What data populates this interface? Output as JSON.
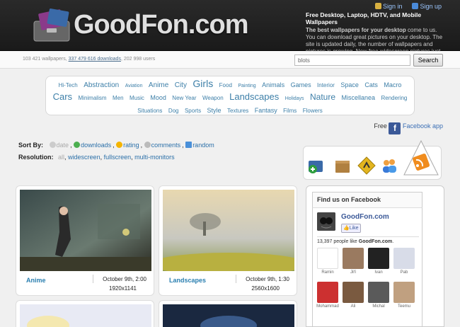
{
  "header": {
    "logo": "GoodFon.com",
    "sign_in": "Sign in",
    "sign_up": "Sign up",
    "tagline_title": "Free Desktop, Laptop, HDTV, and Mobile Wallpapers",
    "tagline_bold": "The best wallpapers for your desktop",
    "tagline_rest": " come to us. You can download great pictures on your desktop. The site is updated daily, the number of wallpapers and pictures is growing. New free widescreen pictures just for you."
  },
  "stats": {
    "wallpapers": "103 421 wallpapers,",
    "downloads": "337 479 616 downloads",
    "users": ", 202 998 users"
  },
  "search": {
    "value": "blots",
    "button": "Search"
  },
  "tags": [
    {
      "t": "Hi-Tech",
      "s": 8
    },
    {
      "t": "Abstraction",
      "s": 10
    },
    {
      "t": "Aviation",
      "s": 7
    },
    {
      "t": "Anime",
      "s": 10
    },
    {
      "t": "City",
      "s": 10
    },
    {
      "t": "Girls",
      "s": 14
    },
    {
      "t": "Food",
      "s": 8
    },
    {
      "t": "Painting",
      "s": 7
    },
    {
      "t": "Animals",
      "s": 9
    },
    {
      "t": "Games",
      "s": 9
    },
    {
      "t": "Interior",
      "s": 8
    },
    {
      "t": "Space",
      "s": 9
    },
    {
      "t": "Cats",
      "s": 9
    },
    {
      "t": "Macro",
      "s": 9
    },
    {
      "t": "Cars",
      "s": 13
    },
    {
      "t": "Minimalism",
      "s": 8
    },
    {
      "t": "Men",
      "s": 8
    },
    {
      "t": "Music",
      "s": 8
    },
    {
      "t": "Mood",
      "s": 9
    },
    {
      "t": "New Year",
      "s": 8
    },
    {
      "t": "Weapon",
      "s": 8
    },
    {
      "t": "Landscapes",
      "s": 13
    },
    {
      "t": "Holidays",
      "s": 7
    },
    {
      "t": "Nature",
      "s": 12
    },
    {
      "t": "Miscellanea",
      "s": 9
    },
    {
      "t": "Rendering",
      "s": 8
    },
    {
      "t": "Situations",
      "s": 8
    },
    {
      "t": "Dog",
      "s": 8
    },
    {
      "t": "Sports",
      "s": 8
    },
    {
      "t": "Style",
      "s": 9
    },
    {
      "t": "Textures",
      "s": 8
    },
    {
      "t": "Fantasy",
      "s": 9
    },
    {
      "t": "Films",
      "s": 8
    },
    {
      "t": "Flowers",
      "s": 8
    }
  ],
  "fbapp": {
    "free": "Free",
    "link": "Facebook app"
  },
  "sort": {
    "label": "Sort By:",
    "options": [
      "date",
      "downloads",
      "rating",
      "comments",
      "random"
    ]
  },
  "resolution": {
    "label": "Resolution:",
    "options": [
      "all",
      "widescreen",
      "fullscreen",
      "multi-monitors"
    ]
  },
  "cards": [
    {
      "category": "Anime",
      "date": "October 9th, 2:00",
      "res": "1920x1141"
    },
    {
      "category": "Landscapes",
      "date": "October 9th, 1:30",
      "res": "2560x1600"
    }
  ],
  "facebook": {
    "title": "Find us on Facebook",
    "page_name": "GoodFon.com",
    "like": "Like",
    "count_prefix": "13,397 people like ",
    "count_page": "GoodFon.com",
    "count_suffix": ".",
    "fans": [
      "Ramin",
      "Jiří",
      "Ivan",
      "Pab",
      "Mohammad",
      "Ali",
      "Michal",
      "Teemu"
    ]
  }
}
